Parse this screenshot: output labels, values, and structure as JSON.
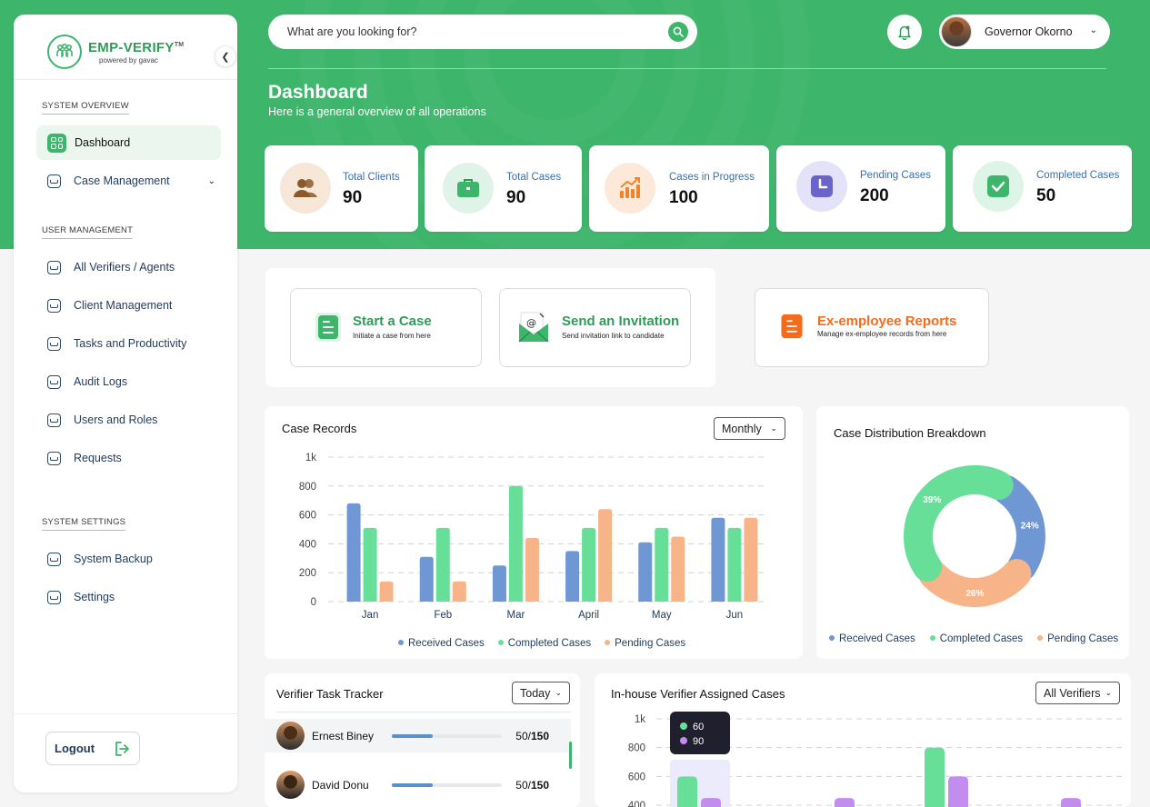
{
  "colors": {
    "brand_green": "#3db56b",
    "received": "#6f97d4",
    "completed": "#67df98",
    "pending": "#f6b488",
    "accent_orange": "#f36b1c",
    "purple": "#c38cef"
  },
  "brand": {
    "name": "EMP-VERIFY",
    "tm": "TM",
    "tagline": "powered by gavac"
  },
  "sidebar": {
    "sections": [
      {
        "label": "SYSTEM OVERVIEW"
      },
      {
        "label": "USER MANAGEMENT"
      },
      {
        "label": "SYSTEM SETTINGS"
      }
    ],
    "items": [
      {
        "label": "Dashboard",
        "icon": "dashboard-icon",
        "active": true
      },
      {
        "label": "Case Management",
        "icon": "inbox-icon",
        "has_dropdown": true
      },
      {
        "label": "All Verifiers / Agents",
        "icon": "inbox-icon"
      },
      {
        "label": "Client Management",
        "icon": "inbox-icon"
      },
      {
        "label": "Tasks and Productivity",
        "icon": "inbox-icon"
      },
      {
        "label": "Audit Logs",
        "icon": "inbox-icon"
      },
      {
        "label": "Users and Roles",
        "icon": "inbox-icon"
      },
      {
        "label": "Requests",
        "icon": "inbox-icon"
      },
      {
        "label": "System Backup",
        "icon": "inbox-icon"
      },
      {
        "label": "Settings",
        "icon": "inbox-icon"
      }
    ],
    "logout_label": "Logout"
  },
  "topbar": {
    "search_placeholder": "What are you looking for?",
    "user_name": "Governor Okorno"
  },
  "header": {
    "title": "Dashboard",
    "subtitle": "Here is a general overview of all operations"
  },
  "stats": [
    {
      "label": "Total Clients",
      "value": "90",
      "icon": "users-icon"
    },
    {
      "label": "Total Cases",
      "value": "90",
      "icon": "briefcase-icon"
    },
    {
      "label": "Cases in Progress",
      "value": "100",
      "icon": "trending-up-icon"
    },
    {
      "label": "Pending Cases",
      "value": "200",
      "icon": "clock-icon"
    },
    {
      "label": "Completed Cases",
      "value": "50",
      "icon": "check-icon"
    }
  ],
  "actions": [
    {
      "title": "Start a Case",
      "subtitle": "Initiate a case from here"
    },
    {
      "title": "Send an Invitation",
      "subtitle": "Send invitation link to candidate"
    },
    {
      "title": "Ex-employee Reports",
      "subtitle": "Manage ex-employee records from here"
    }
  ],
  "case_records": {
    "title": "Case Records",
    "filter": "Monthly"
  },
  "distribution": {
    "title": "Case Distribution Breakdown"
  },
  "tracker": {
    "title": "Verifier Task Tracker",
    "filter": "Today",
    "rows": [
      {
        "name": "Ernest Biney",
        "done": "50",
        "total": "150",
        "progress": 0.37
      },
      {
        "name": "David Donu",
        "done": "50",
        "total": "150",
        "progress": 0.37
      }
    ]
  },
  "inhouse": {
    "title": "In-house Verifier Assigned Cases",
    "filter": "All Verifiers",
    "tooltip": {
      "green_value": "60",
      "purple_value": "90"
    }
  },
  "chart_data": [
    {
      "type": "bar",
      "title": "Case Records",
      "categories": [
        "Jan",
        "Feb",
        "Mar",
        "April",
        "May",
        "Jun"
      ],
      "series": [
        {
          "name": "Received Cases",
          "values": [
            680,
            310,
            250,
            350,
            410,
            580
          ]
        },
        {
          "name": "Completed Cases",
          "values": [
            510,
            510,
            800,
            510,
            510,
            510
          ]
        },
        {
          "name": "Pending Cases",
          "values": [
            140,
            140,
            440,
            640,
            450,
            580
          ]
        }
      ],
      "ylim": [
        0,
        1000
      ],
      "y_ticks": [
        "0",
        "200",
        "400",
        "600",
        "800",
        "1k"
      ],
      "legend": "bottom",
      "grid": true
    },
    {
      "type": "pie",
      "title": "Case Distribution Breakdown",
      "style": "donut",
      "slices": [
        {
          "name": "Received Cases",
          "value": 24,
          "label": "24%"
        },
        {
          "name": "Pending Cases",
          "value": 26,
          "label": "26%"
        },
        {
          "name": "Completed Cases",
          "value": 39,
          "label": "39%"
        }
      ],
      "legend_order": [
        "Received Cases",
        "Completed Cases",
        "Pending Cases"
      ],
      "legend": "bottom"
    },
    {
      "type": "bar",
      "title": "In-house Verifier Assigned Cases",
      "y_ticks": [
        "400",
        "600",
        "800",
        "1k"
      ],
      "ylim": [
        400,
        1000
      ],
      "series": [
        {
          "name": "green",
          "values": [
            600,
            null,
            null,
            800,
            null
          ]
        },
        {
          "name": "purple",
          "values": [
            450,
            null,
            450,
            600,
            450
          ]
        }
      ],
      "grid": true
    }
  ]
}
